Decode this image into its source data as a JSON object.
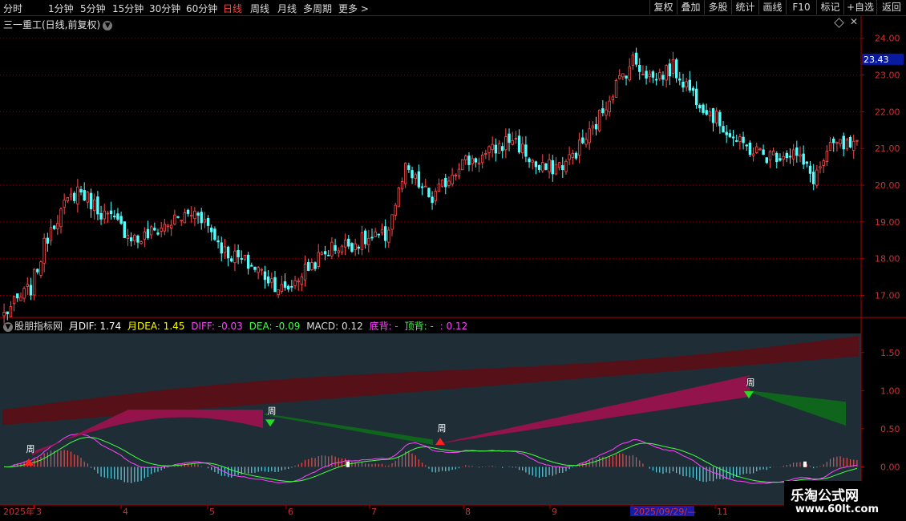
{
  "toolbar": {
    "timeframes": [
      "分时",
      "1分钟",
      "5分钟",
      "15分钟",
      "30分钟",
      "60分钟",
      "日线",
      "周线",
      "月线",
      "多周期",
      "更多 >"
    ],
    "active_timeframe": "日线",
    "right_buttons": [
      "复权",
      "叠加",
      "多股",
      "统计",
      "画线",
      "F10",
      "标记",
      "+自选",
      "返回"
    ]
  },
  "price_panel": {
    "title": "三一重工(日线,前复权)",
    "current_price_label": "23.43",
    "y_ticks": [
      "24.00",
      "23.00",
      "22.00",
      "21.00",
      "20.00",
      "19.00",
      "18.00",
      "17.00"
    ]
  },
  "indicator_panel": {
    "name": "股朋指标网",
    "values": [
      {
        "label": "月DIF: 1.74",
        "color": "#ffffff"
      },
      {
        "label": "月DEA: 1.45",
        "color": "#ffff00"
      },
      {
        "label": "DIFF: -0.03",
        "color": "#ff44ff"
      },
      {
        "label": "DEA: -0.09",
        "color": "#44ff44"
      },
      {
        "label": "MACD: 0.12",
        "color": "#dddddd"
      },
      {
        "label": "底背: -",
        "color": "#ff44ff"
      },
      {
        "label": "顶背: -",
        "color": "#44ff44"
      },
      {
        "label": ": 0.12",
        "color": "#ff44ff"
      }
    ],
    "y_ticks": [
      "1.50",
      "1.00",
      "0.50",
      "0.00"
    ],
    "markers": [
      "周",
      "周",
      "周",
      "周"
    ]
  },
  "x_axis": {
    "labels": [
      "2025年",
      "3",
      "4",
      "5",
      "6",
      "7",
      "8",
      "9",
      "2025/09/29/—",
      "11"
    ]
  },
  "watermark": {
    "line1": "乐淘公式网",
    "line2": "www.60lt.com"
  },
  "colors": {
    "up": "#ff4d4d",
    "down": "#54ffff",
    "axis": "#b00000",
    "grid": "#8a0000",
    "indicator_bg": "#1f2d37"
  },
  "chart_data": {
    "type": "candlestick+macd",
    "price_ylim": [
      16.4,
      24.3
    ],
    "macd_ylim": [
      -0.5,
      1.75
    ],
    "anchors": [
      [
        0,
        16.5
      ],
      [
        8,
        17.2
      ],
      [
        14,
        18.9
      ],
      [
        22,
        19.9
      ],
      [
        30,
        19.2
      ],
      [
        40,
        18.5
      ],
      [
        50,
        19.0
      ],
      [
        58,
        19.3
      ],
      [
        66,
        18.2
      ],
      [
        76,
        17.7
      ],
      [
        84,
        17.1
      ],
      [
        90,
        17.7
      ],
      [
        98,
        18.3
      ],
      [
        108,
        18.5
      ],
      [
        114,
        18.6
      ],
      [
        120,
        20.4
      ],
      [
        128,
        19.6
      ],
      [
        136,
        20.6
      ],
      [
        144,
        20.8
      ],
      [
        152,
        21.3
      ],
      [
        160,
        20.4
      ],
      [
        168,
        20.6
      ],
      [
        176,
        21.5
      ],
      [
        182,
        22.6
      ],
      [
        188,
        23.4
      ],
      [
        194,
        22.9
      ],
      [
        200,
        23.2
      ],
      [
        206,
        22.5
      ],
      [
        212,
        21.9
      ],
      [
        220,
        21.1
      ],
      [
        228,
        20.8
      ],
      [
        236,
        20.9
      ],
      [
        242,
        20.2
      ],
      [
        248,
        21.1
      ],
      [
        256,
        21.0
      ]
    ],
    "dif_month_range": [
      0.75,
      1.74
    ],
    "dea_month_range": [
      0.55,
      1.45
    ]
  }
}
